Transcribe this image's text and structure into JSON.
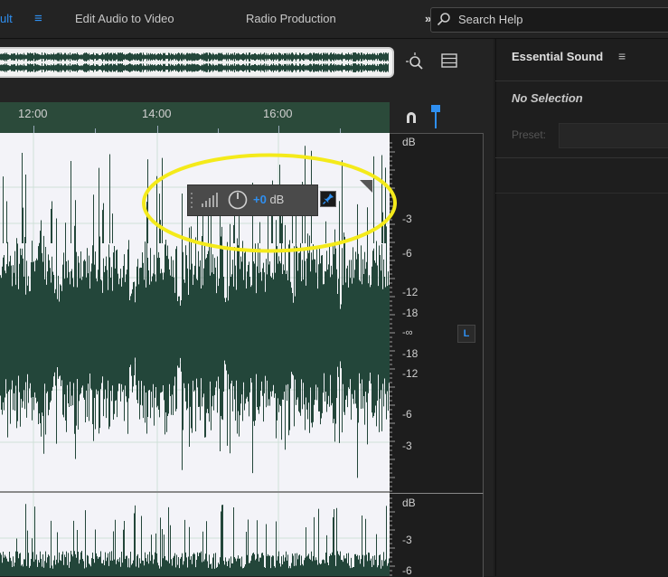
{
  "topbar": {
    "workspace_default_partial": "ult",
    "workspace_menu_icon": "≡",
    "workspace_edit_audio": "Edit Audio to Video",
    "workspace_radio": "Radio Production",
    "more": "»",
    "search_placeholder": "Search Help"
  },
  "editor": {
    "ruler_labels": [
      "12:00",
      "14:00",
      "16:00"
    ],
    "db_scale_top": [
      "dB",
      "-3",
      "-6",
      "-12",
      "-18",
      "-∞",
      "-18",
      "-12",
      "-6",
      "-3"
    ],
    "db_scale_bottom": [
      "dB",
      "-3",
      "-6"
    ],
    "channel_label": "L",
    "hud": {
      "value": "+0",
      "unit": "dB"
    }
  },
  "panel": {
    "title": "Essential Sound",
    "menu_icon": "≡",
    "no_selection": "No Selection",
    "preset_label": "Preset:"
  },
  "colors": {
    "accent": "#2f8ff0",
    "waveform": "#23463a",
    "highlight": "#f4ea1a"
  },
  "icons": [
    "search-icon",
    "zoom-icon",
    "list-icon",
    "magnet-icon",
    "marker-icon",
    "volume-bars-icon",
    "knob-icon",
    "pin-icon"
  ]
}
